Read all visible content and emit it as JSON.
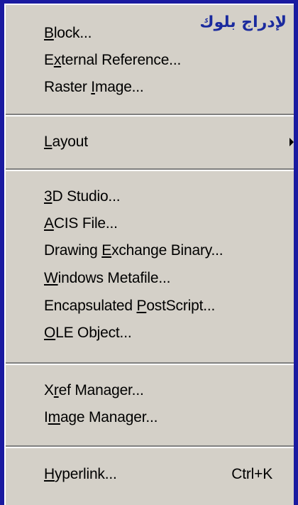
{
  "overlay_text": "لإدراج بلوك",
  "menu": {
    "items": [
      {
        "pre": "",
        "key": "B",
        "post": "lock..."
      },
      {
        "pre": "E",
        "key": "x",
        "post": "ternal Reference..."
      },
      {
        "pre": "Raster ",
        "key": "I",
        "post": "mage..."
      },
      {
        "pre": "",
        "key": "L",
        "post": "ayout"
      },
      {
        "pre": "",
        "key": "3",
        "post": "D Studio..."
      },
      {
        "pre": "",
        "key": "A",
        "post": "CIS File..."
      },
      {
        "pre": "Drawing ",
        "key": "E",
        "post": "xchange Binary..."
      },
      {
        "pre": "",
        "key": "W",
        "post": "indows Metafile..."
      },
      {
        "pre": "Encapsulated ",
        "key": "P",
        "post": "ostScript..."
      },
      {
        "pre": "",
        "key": "O",
        "post": "LE Object..."
      },
      {
        "pre": "X",
        "key": "r",
        "post": "ef Manager..."
      },
      {
        "pre": "I",
        "key": "m",
        "post": "age Manager..."
      },
      {
        "pre": "",
        "key": "H",
        "post": "yperlink..."
      }
    ],
    "hyperlink_shortcut": "Ctrl+K"
  },
  "colors": {
    "menu_bg": "#d4d0c8",
    "frame": "#1a1aa0",
    "overlay_text": "#1a2a9e"
  }
}
